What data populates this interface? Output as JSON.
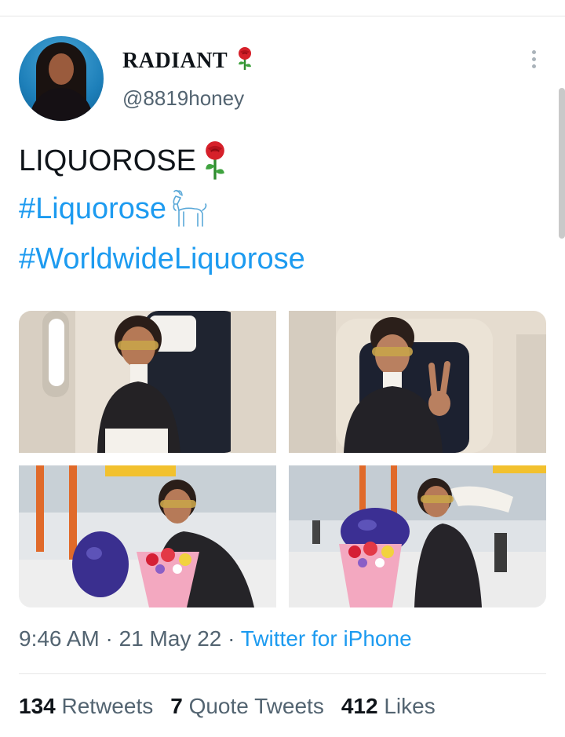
{
  "user": {
    "display_name": "RADIANT",
    "handle": "@8819honey"
  },
  "tweet": {
    "text": "LIQUOROSE",
    "hashtags": [
      "#Liquorose",
      "#WorldwideLiquorose"
    ]
  },
  "meta": {
    "time": "9:46 AM",
    "separator": " · ",
    "date": "21 May 22",
    "source": "Twitter for iPhone"
  },
  "stats": {
    "retweets_count": "134",
    "retweets_label": "Retweets",
    "quote_count": "7",
    "quote_label": "Quote Tweets",
    "likes_count": "412",
    "likes_label": "Likes"
  },
  "icons": [
    "rose-icon",
    "goat-icon",
    "more-options-icon"
  ],
  "colors": {
    "link": "#1d9bf0",
    "text": "#0f1419",
    "secondary": "#536471"
  }
}
